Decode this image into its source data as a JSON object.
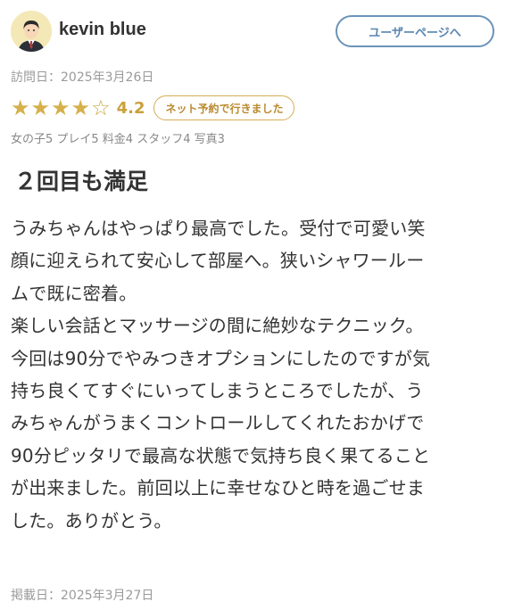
{
  "user": {
    "name": "kevin blue",
    "profile_button_label": "ユーザーページへ"
  },
  "review": {
    "visit_date": "訪問日：2025年3月26日",
    "rating": {
      "stars_filled": 4,
      "stars_total": 5,
      "score": "4.2",
      "star_color": "#d6b04a"
    },
    "booking_badge": "ネット予約で行きました",
    "sub_ratings": "女の子5 プレイ5 料金4 スタッフ4 写真3",
    "title": "２回目も満足",
    "body": "うみちゃんはやっぱり最高でした。受付で可愛い笑\n顔に迎えられて安心して部屋へ。狭いシャワールー\nムで既に密着。\n楽しい会話とマッサージの間に絶妙なテクニック。\n今回は90分でやみつきオプションにしたのですが気\n持ち良くてすぐにいってしまうところでしたが、う\nみちゃんがうまくコントロールしてくれたおかげで\n90分ピッタリで最高な状態で気持ち良く果てること\nが出来ました。前回以上に幸せなひと時を過ごせま\nした。ありがとう。",
    "posted_date": "掲載日：2025年3月27日"
  },
  "icons": {
    "avatar": "user-avatar-illustration",
    "star_filled": "star-filled-icon",
    "star_empty": "star-outline-icon"
  }
}
